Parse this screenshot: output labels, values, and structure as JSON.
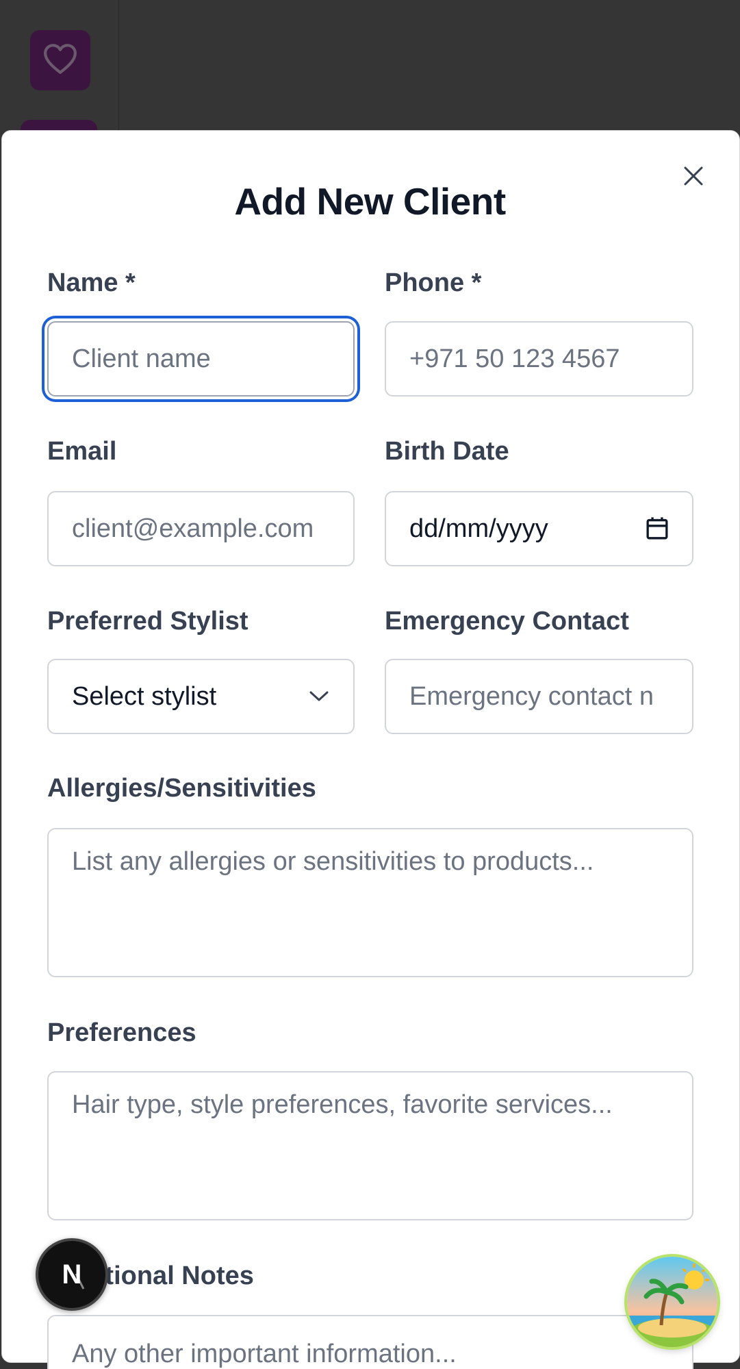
{
  "background": {
    "logo_icon": "heart-icon"
  },
  "modal": {
    "title": "Add New Client",
    "close_icon": "close-icon",
    "fields": {
      "name": {
        "label": "Name *",
        "placeholder": "Client name"
      },
      "phone": {
        "label": "Phone *",
        "placeholder": "+971 50 123 4567"
      },
      "email": {
        "label": "Email",
        "placeholder": "client@example.com"
      },
      "birth_date": {
        "label": "Birth Date",
        "value": "dd/mm/yyyy",
        "icon": "calendar-icon"
      },
      "stylist": {
        "label": "Preferred Stylist",
        "value": "Select stylist",
        "icon": "chevron-down-icon"
      },
      "emergency": {
        "label": "Emergency Contact",
        "placeholder": "Emergency contact n"
      },
      "allergies": {
        "label": "Allergies/Sensitivities",
        "placeholder": "List any allergies or sensitivities to products..."
      },
      "preferences": {
        "label": "Preferences",
        "placeholder": "Hair type, style preferences, favorite services..."
      },
      "notes": {
        "label": "Additional Notes",
        "placeholder": "Any other important information..."
      }
    }
  },
  "overlays": {
    "dev_badge_letter": "N",
    "floating_button_icon": "island-icon"
  },
  "colors": {
    "focus_ring": "#1d5fd6",
    "backdrop": "#353535",
    "brand": "#3b1440"
  }
}
